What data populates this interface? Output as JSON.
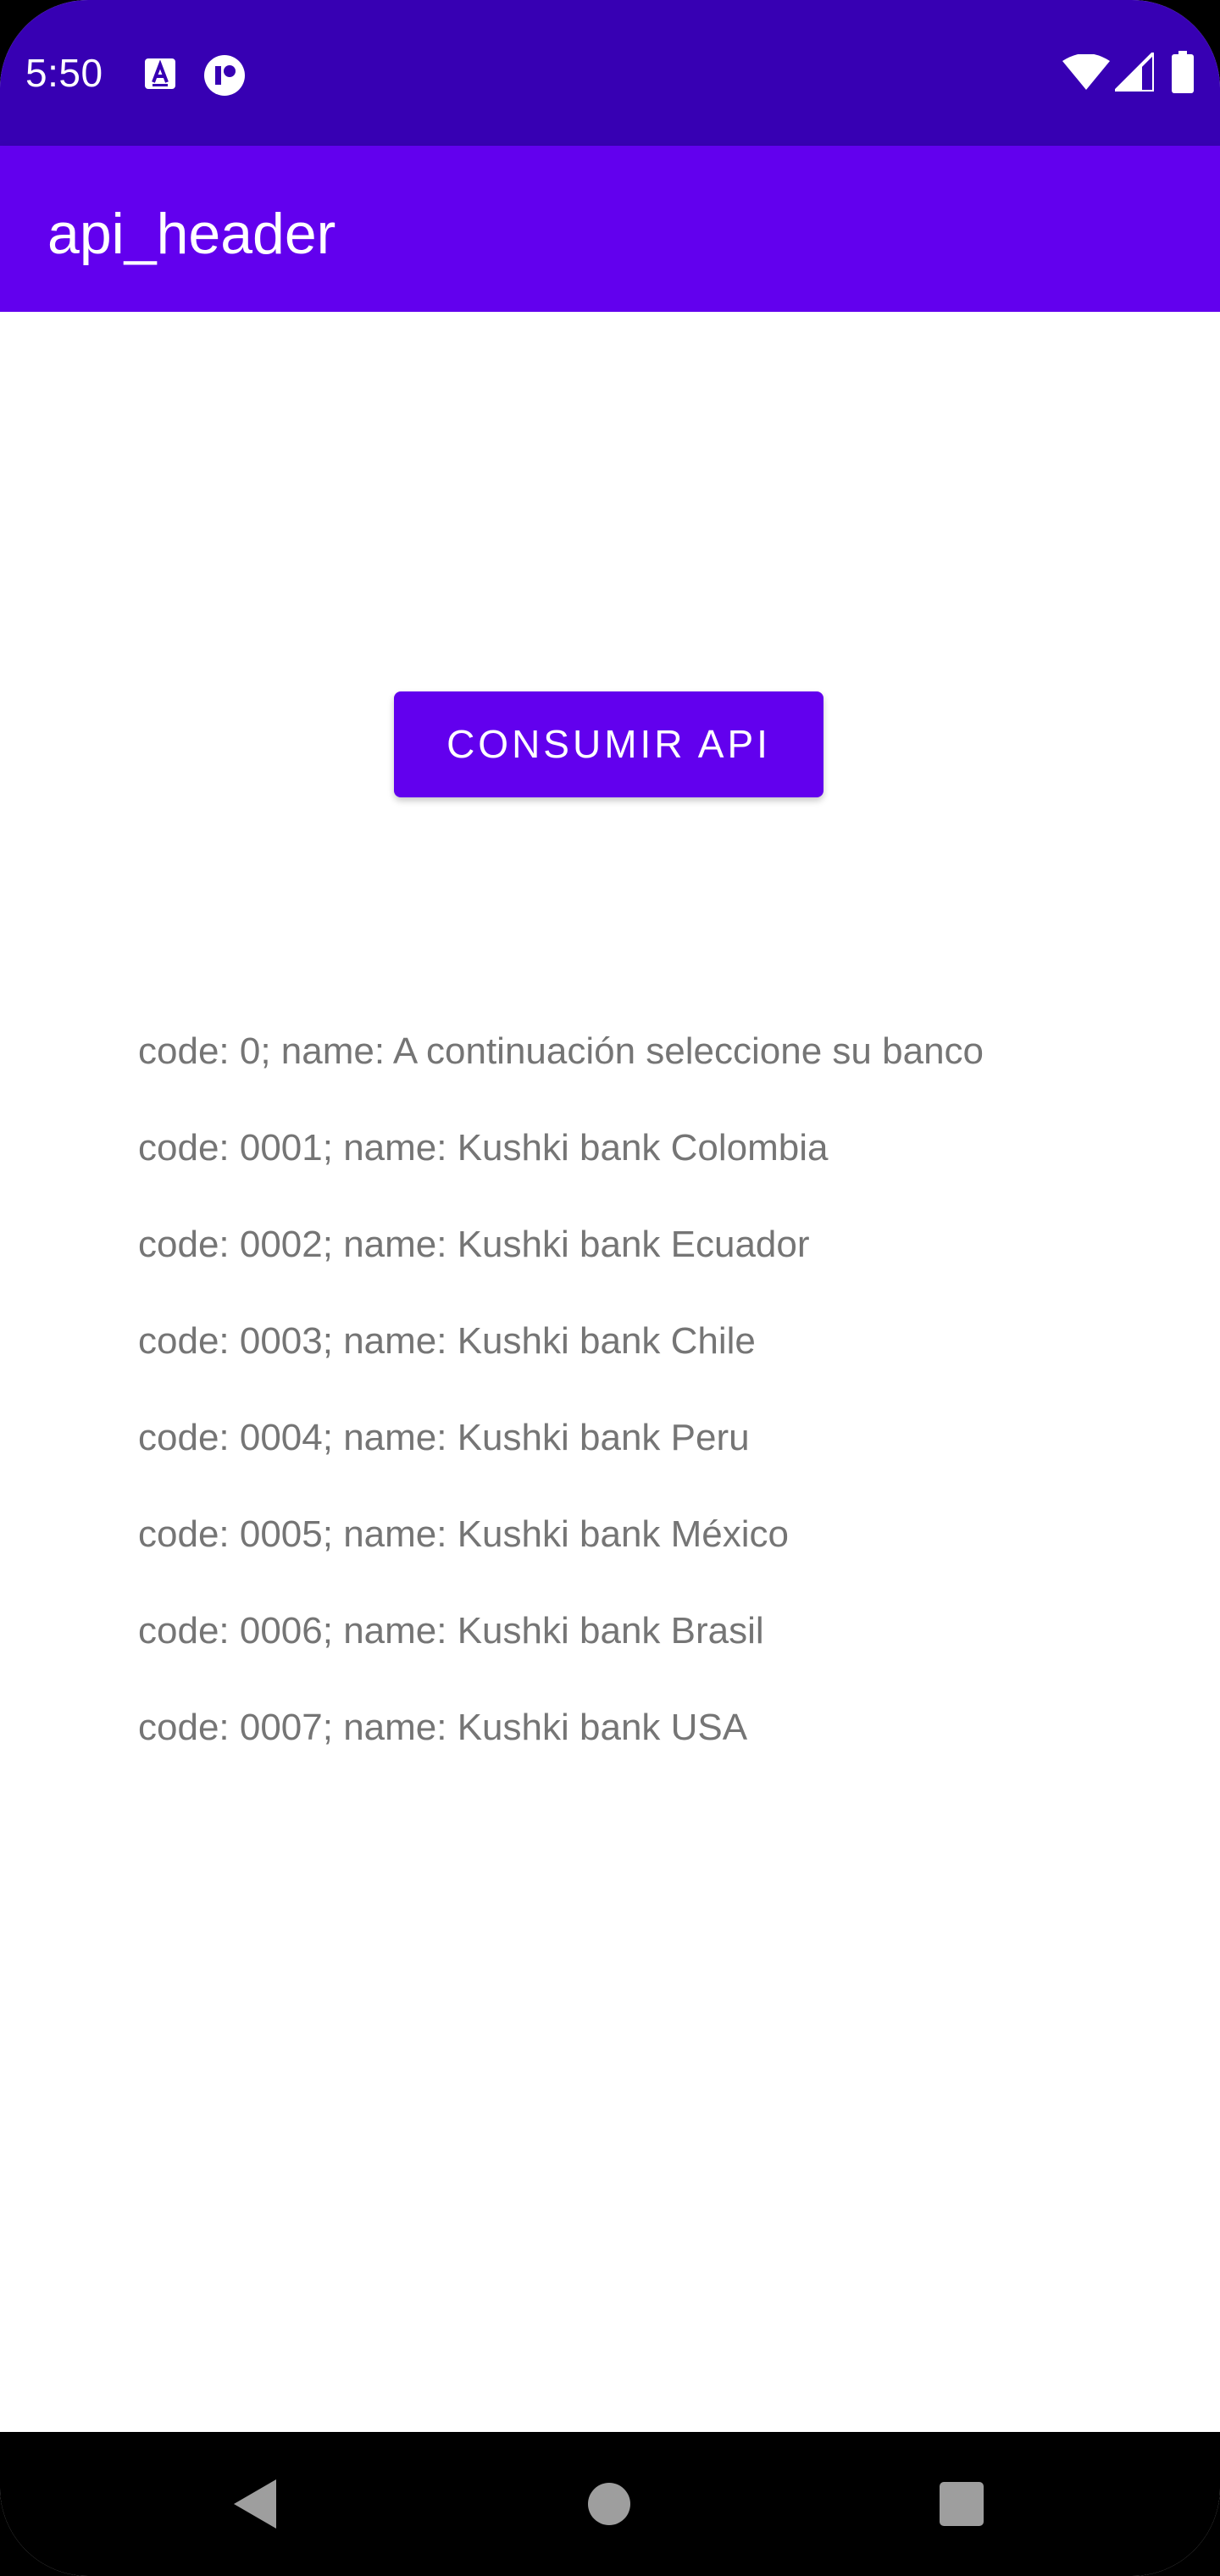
{
  "status_bar": {
    "time": "5:50",
    "icons": [
      "text-notification-icon",
      "app-notification-icon",
      "wifi-icon",
      "signal-icon",
      "battery-icon"
    ]
  },
  "app_bar": {
    "title": "api_header"
  },
  "main": {
    "consume_button_label": "CONSUMIR API",
    "banks": [
      "code: 0; name: A continuación seleccione su banco",
      "code: 0001; name: Kushki bank Colombia",
      "code: 0002; name: Kushki bank Ecuador",
      "code: 0003; name: Kushki bank Chile",
      "code: 0004; name: Kushki bank Peru",
      "code: 0005; name: Kushki bank México",
      "code: 0006; name: Kushki bank Brasil",
      "code: 0007; name: Kushki bank USA"
    ]
  },
  "nav_bar": {
    "icons": [
      "back-icon",
      "home-icon",
      "recents-icon"
    ]
  },
  "colors": {
    "status_bar": "#3700b3",
    "primary": "#6200ee",
    "list_text": "#757575",
    "background": "#ffffff"
  }
}
